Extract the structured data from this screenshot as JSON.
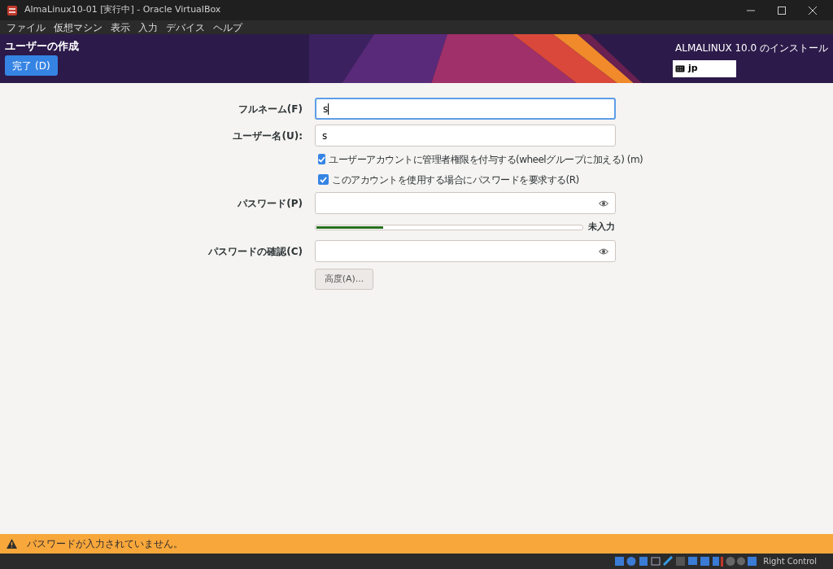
{
  "window": {
    "title": "AlmaLinux10-01 [実行中] - Oracle VirtualBox"
  },
  "menu": [
    "ファイル",
    "仮想マシン",
    "表示",
    "入力",
    "デバイス",
    "ヘルプ"
  ],
  "header": {
    "title": "ユーザーの作成",
    "done_button": "完了 (D)",
    "product": "ALMALINUX 10.0 のインストール",
    "keyboard_layout": "jp"
  },
  "form": {
    "rows": [
      {
        "kind": "field",
        "label": "フルネーム(F)",
        "value": "s",
        "focused": true,
        "password": false
      },
      {
        "kind": "field",
        "label": "ユーザー名(U):",
        "value": "s",
        "focused": false,
        "password": false
      },
      {
        "kind": "checkbox",
        "label": "ユーザーアカウントに管理者権限を付与する(wheelグループに加える) (m)",
        "checked": true
      },
      {
        "kind": "checkbox",
        "label": "このアカウントを使用する場合にパスワードを要求する(R)",
        "checked": true
      },
      {
        "kind": "field",
        "label": "パスワード(P)",
        "value": "",
        "focused": false,
        "password": true
      },
      {
        "kind": "meter",
        "level": 0.25,
        "reading": "未入力"
      },
      {
        "kind": "field",
        "label": "パスワードの確認(C)",
        "value": "",
        "focused": false,
        "password": true
      },
      {
        "kind": "button",
        "label": "高度(A)..."
      }
    ]
  },
  "warning_bar": {
    "message": "パスワードが入力されていません。"
  },
  "status_bar": {
    "host_key": "Right Control"
  }
}
